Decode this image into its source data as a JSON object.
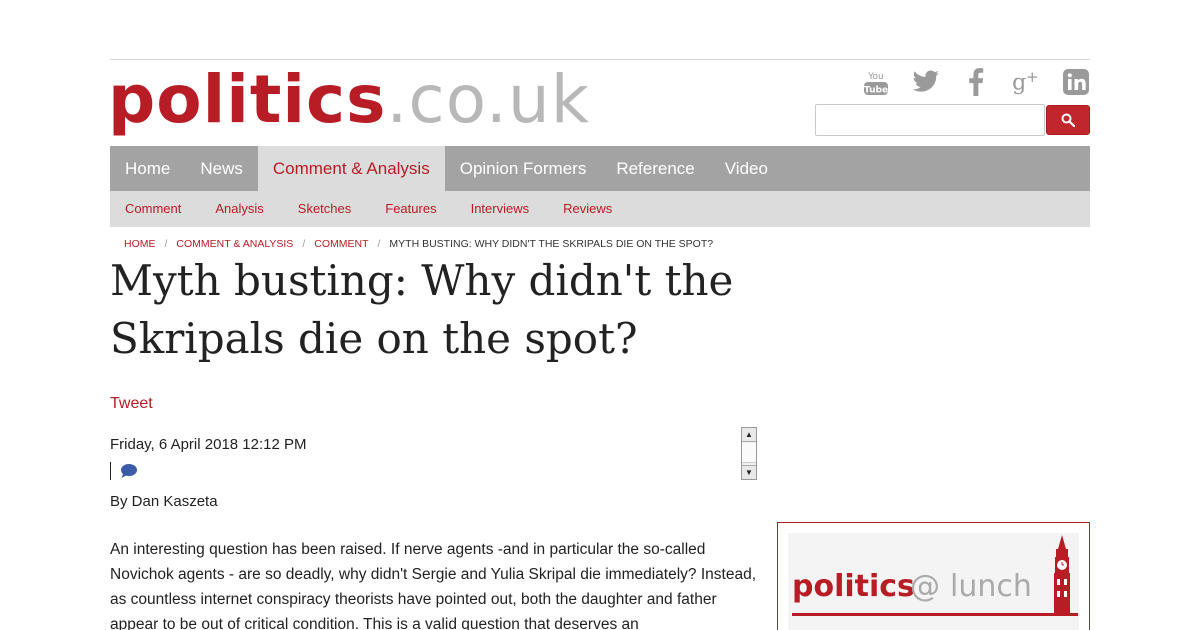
{
  "logo": {
    "main": "politics",
    "tld": ".co.uk"
  },
  "social": [
    {
      "icon": "youtube-icon",
      "label": "You Tube"
    },
    {
      "icon": "twitter-icon"
    },
    {
      "icon": "facebook-icon"
    },
    {
      "icon": "google-plus-icon"
    },
    {
      "icon": "linkedin-icon"
    }
  ],
  "search": {
    "placeholder": ""
  },
  "nav": {
    "items": [
      "Home",
      "News",
      "Comment & Analysis",
      "Opinion Formers",
      "Reference",
      "Video"
    ],
    "active": "Comment & Analysis"
  },
  "subnav": {
    "items": [
      "Comment",
      "Analysis",
      "Sketches",
      "Features",
      "Interviews",
      "Reviews"
    ]
  },
  "breadcrumb": {
    "home": "Home",
    "section": "Comment & Analysis",
    "subsection": "Comment",
    "current": "Myth busting: Why didn't the Skripals die on the spot?"
  },
  "article": {
    "title": "Myth busting: Why didn't the Skripals die on the spot?",
    "tweet_label": "Tweet",
    "date": "Friday, 6 April 2018 12:12 PM",
    "byline": "By Dan Kaszeta",
    "body": "An interesting question has been raised. If nerve agents -and in particular the so-called Novichok agents - are so deadly, why didn't Sergie and Yulia Skripal die immediately? Instead, as countless internet conspiracy theorists have pointed out, both the daughter and father appear to be out of critical condition. This is a valid question that deserves an"
  },
  "ad": {
    "brand_left": "politics",
    "brand_at": "@",
    "brand_right": "lunch"
  },
  "colors": {
    "brand_red": "#b81c24",
    "nav_grey": "#a3a3a3",
    "subnav_grey": "#dcdcdc"
  }
}
